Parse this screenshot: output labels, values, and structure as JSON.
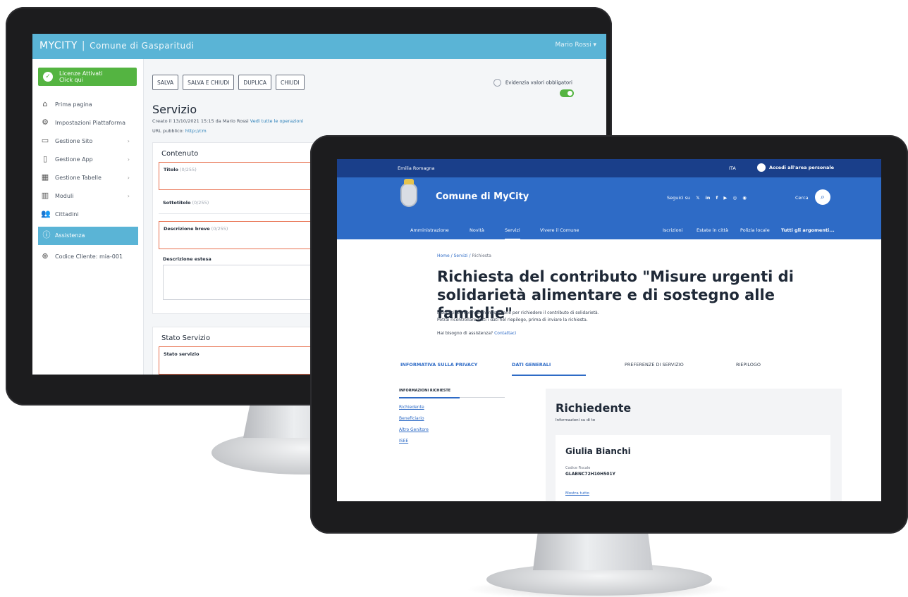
{
  "admin": {
    "brand": "MYCITY",
    "org": "Comune di Gasparitudi",
    "user": "Mario Rossi ▾",
    "licence": "Licenze Attivati\nClick qui",
    "nav": [
      {
        "icon": "⌂",
        "label": "Prima pagina",
        "chevron": ""
      },
      {
        "icon": "⚙",
        "label": "Impostazioni Piattaforma",
        "chevron": ""
      },
      {
        "icon": "▭",
        "label": "Gestione Sito",
        "chevron": "›"
      },
      {
        "icon": "▯",
        "label": "Gestione App",
        "chevron": "›"
      },
      {
        "icon": "▦",
        "label": "Gestione Tabelle",
        "chevron": "›"
      },
      {
        "icon": "▥",
        "label": "Moduli",
        "chevron": "›"
      },
      {
        "icon": "👥",
        "label": "Cittadini",
        "chevron": ""
      }
    ],
    "active_nav": {
      "icon": "ⓘ",
      "label": "Assistenza"
    },
    "extra_nav": {
      "icon": "⊕",
      "label": "Codice Cliente: mia-001"
    },
    "toolbar": [
      "SALVA",
      "SALVA E CHIUDI",
      "DUPLICA",
      "CHIUDI"
    ],
    "required_label": "Evidenzia valori obbligatori",
    "title": "Servizio",
    "meta_text": "Creato il 13/10/2021 15:15 da Mario Rossi",
    "meta_link": "Vedi tutte le operazioni",
    "url_label": "URL pubblico:",
    "url_link": "http://cm",
    "content_card_title": "Contenuto",
    "field_title": "Titolo",
    "field_title_sub": "(0/255)",
    "field_subtitle": "Sottotitolo",
    "field_subtitle_sub": "(0/255)",
    "field_short_desc": "Descrizione breve",
    "field_short_desc_sub": "(0/255)",
    "field_long_desc": "Descrizione estesa",
    "status_card_title": "Stato Servizio",
    "status_field": "Stato servizio"
  },
  "site": {
    "region": "Emilia Romagna",
    "lang": "ITA",
    "login": "Accedi all'area personale",
    "name": "Comune di MyCity",
    "social_label": "Seguici su",
    "social_icons": [
      "𝕏",
      "in",
      "f",
      "▶",
      "◎",
      "◉"
    ],
    "search_label": "Cerca",
    "menu": [
      "Amministrazione",
      "Novità",
      "Servizi",
      "Vivere il Comune"
    ],
    "menu_right": [
      "Iscrizioni",
      "Estate in città",
      "Polizia locale",
      "Tutti gli argomenti..."
    ],
    "active_menu": "Servizi",
    "breadcrumb_home": "Home",
    "breadcrumb_mid": "Servizi",
    "breadcrumb_cur": "Richiesta",
    "breadcrumb_sep": "/",
    "title": "Richiesta del contributo \"Misure urgenti di solidarietà alimentare e di sostegno alle famiglie\"",
    "intro_line1": "Inserisci le informazioni necessarie per richiedere il contributo di solidarietà.",
    "intro_line2": "Potrai ricontrollare tutti i dati nel riepilogo, prima di inviare la richiesta.",
    "help_text": "Hai bisogno di assistenza?",
    "help_link": "Contattaci",
    "steps": [
      "INFORMATIVA SULLA PRIVACY",
      "DATI GENERALI",
      "PREFERENZE DI SERVIZIO",
      "RIEPILOGO"
    ],
    "toc_head": "INFORMAZIONI RICHIESTE",
    "toc_links": [
      "Richiedente",
      "Beneficiario",
      "Altro Genitore",
      "ISEE"
    ],
    "panel_title": "Richiedente",
    "panel_sub": "Informazioni su di te",
    "person_name": "Giulia Bianchi",
    "person_label": "Codice Fiscale",
    "person_value": "GLABNC72H10H501Y",
    "person_more": "Mostra tutto"
  },
  "colors": {
    "admin_accent": "#5ab4d6",
    "admin_green": "#54b441",
    "site_primary": "#2e6bc6",
    "site_dark": "#1a3f8a",
    "error_border": "#e8704f"
  }
}
